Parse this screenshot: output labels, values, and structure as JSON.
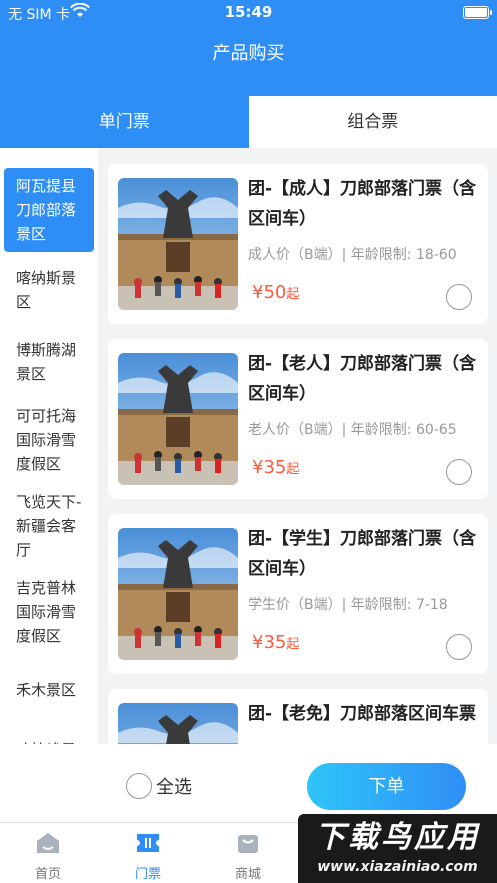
{
  "status": {
    "carrier": "无 SIM 卡",
    "time": "15:49"
  },
  "nav": {
    "title": "产品购买"
  },
  "tabs": [
    {
      "label": "单门票",
      "active": true
    },
    {
      "label": "组合票",
      "active": false
    }
  ],
  "sidebar": {
    "items": [
      {
        "label": "阿瓦提县刀郎部落景区",
        "active": true
      },
      {
        "label": "喀纳斯景区",
        "active": false
      },
      {
        "label": "博斯腾湖景区",
        "active": false
      },
      {
        "label": "可可托海国际滑雪度假区",
        "active": false
      },
      {
        "label": "飞览天下-新疆会客厅",
        "active": false
      },
      {
        "label": "吉克普林国际滑雪度假区",
        "active": false
      },
      {
        "label": "禾木景区",
        "active": false
      },
      {
        "label": "喀拉峻景",
        "active": false
      }
    ]
  },
  "products": [
    {
      "title": "团-【成人】刀郎部落门票（含区间车）",
      "meta": "成人价（B端）| 年龄限制: 18-60",
      "price": "¥50",
      "price_unit": "起"
    },
    {
      "title": "团-【老人】刀郎部落门票（含区间车）",
      "meta": "老人价（B端）| 年龄限制: 60-65",
      "price": "¥35",
      "price_unit": "起"
    },
    {
      "title": "团-【学生】刀郎部落门票（含区间车）",
      "meta": "学生价（B端）| 年龄限制: 7-18",
      "price": "¥35",
      "price_unit": "起"
    },
    {
      "title": "团-【老免】刀郎部落区间车票",
      "meta": "",
      "price": "",
      "price_unit": ""
    }
  ],
  "bottom": {
    "select_all": "全选",
    "order": "下单"
  },
  "tabbar": [
    {
      "label": "首页",
      "icon": "home-icon",
      "active": false
    },
    {
      "label": "门票",
      "icon": "ticket-icon",
      "active": true
    },
    {
      "label": "商城",
      "icon": "shopping-bag-icon",
      "active": false
    }
  ],
  "watermark": {
    "main": "下载鸟应用",
    "url": "www.xiazainiao.com"
  },
  "colors": {
    "primary": "#2f8ef6",
    "price": "#ff5a3d",
    "gradient_start": "#2fc5f9"
  }
}
